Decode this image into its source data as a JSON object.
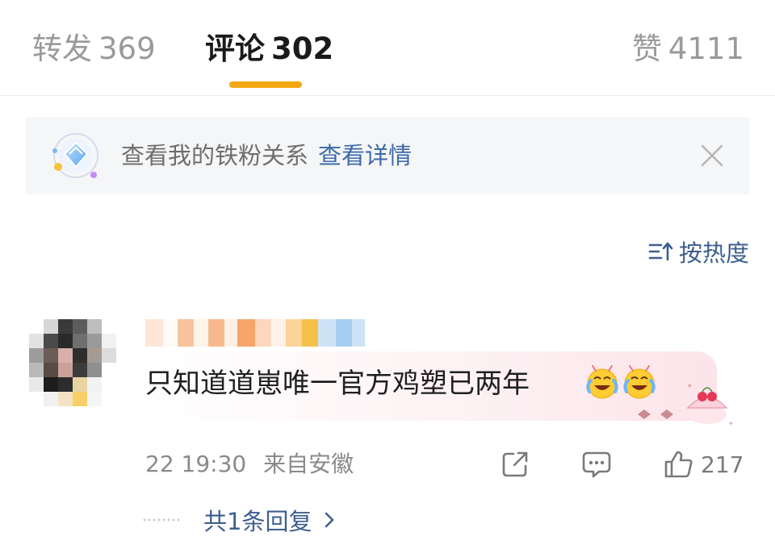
{
  "tabs": {
    "repost": {
      "label": "转发",
      "count": "369"
    },
    "comments": {
      "label": "评论",
      "count": "302"
    },
    "likes": {
      "label": "赞",
      "count": "4111"
    }
  },
  "accent_color": "#f3a712",
  "link_color": "#3d6aa8",
  "fan_banner": {
    "text": "查看我的铁粉关系",
    "link": "查看详情",
    "icon": "diamond-orbit-icon",
    "close_icon": "close-icon"
  },
  "sort": {
    "label": "按热度",
    "icon": "sort-icon"
  },
  "comment": {
    "text": "只知道道崽唯一官方鸡塑已两年",
    "emojis": [
      "crying-laughing-face-icon",
      "crying-laughing-face-icon"
    ],
    "date_fragment": "22",
    "time": "19:30",
    "location": "来自安徽",
    "likes": "217",
    "actions": [
      "share-icon",
      "comment-icon",
      "like-icon"
    ]
  },
  "replies": {
    "label": "共1条回复"
  }
}
